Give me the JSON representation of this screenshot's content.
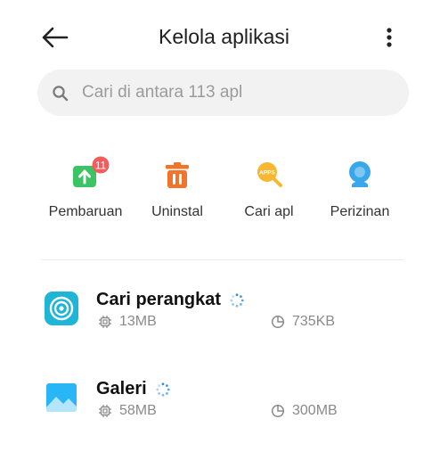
{
  "header": {
    "title": "Kelola aplikasi",
    "back_icon": "arrow-left-icon",
    "more_icon": "more-vertical-icon"
  },
  "search": {
    "placeholder": "Cari di antara 113 apl",
    "icon": "search-icon"
  },
  "actions": [
    {
      "label": "Pembaruan",
      "icon": "update-arrow-icon",
      "color": "#3cc464",
      "badge": "11"
    },
    {
      "label": "Uninstal",
      "icon": "trash-icon",
      "color": "#f2742a"
    },
    {
      "label": "Cari apl",
      "icon": "apps-search-icon",
      "color": "#f7b731"
    },
    {
      "label": "Perizinan",
      "icon": "permissions-icon",
      "color": "#3aa7ea"
    }
  ],
  "badge_color": "#f25c5c",
  "apps": [
    {
      "name": "Cari perangkat",
      "icon": "find-device-icon",
      "storage": "13MB",
      "data": "735KB",
      "icon_color": "#1fb5d6"
    },
    {
      "name": "Galeri",
      "icon": "gallery-icon",
      "storage": "58MB",
      "data": "300MB",
      "icon_color": "#29b6f6"
    }
  ],
  "loading_color": "#2f8fd8"
}
